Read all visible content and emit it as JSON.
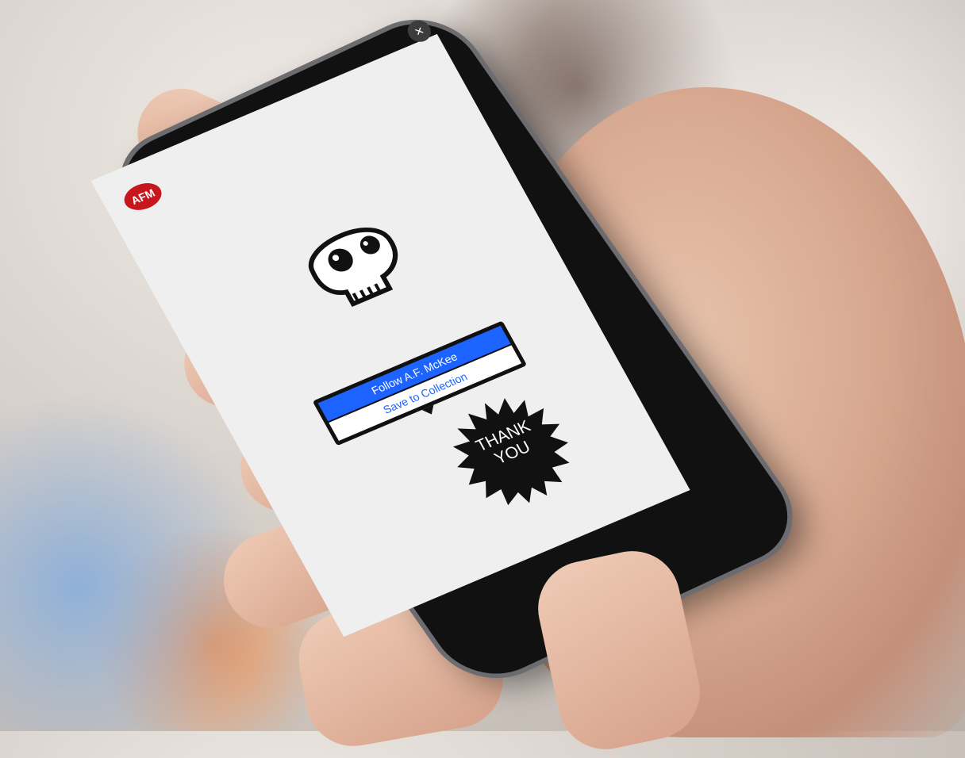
{
  "app": {
    "logo_text": "AFM",
    "close_icon": "close-icon"
  },
  "main": {
    "illustration": "skull-icon",
    "menu": {
      "follow_label": "Follow A.F. McKee",
      "save_label": "Save to Collection"
    },
    "badge": {
      "line1": "THANK",
      "line2": "YOU"
    }
  },
  "colors": {
    "accent_blue": "#1c63ff",
    "logo_red": "#c8161d",
    "screen_bg": "#efefef",
    "badge_black": "#111111"
  }
}
